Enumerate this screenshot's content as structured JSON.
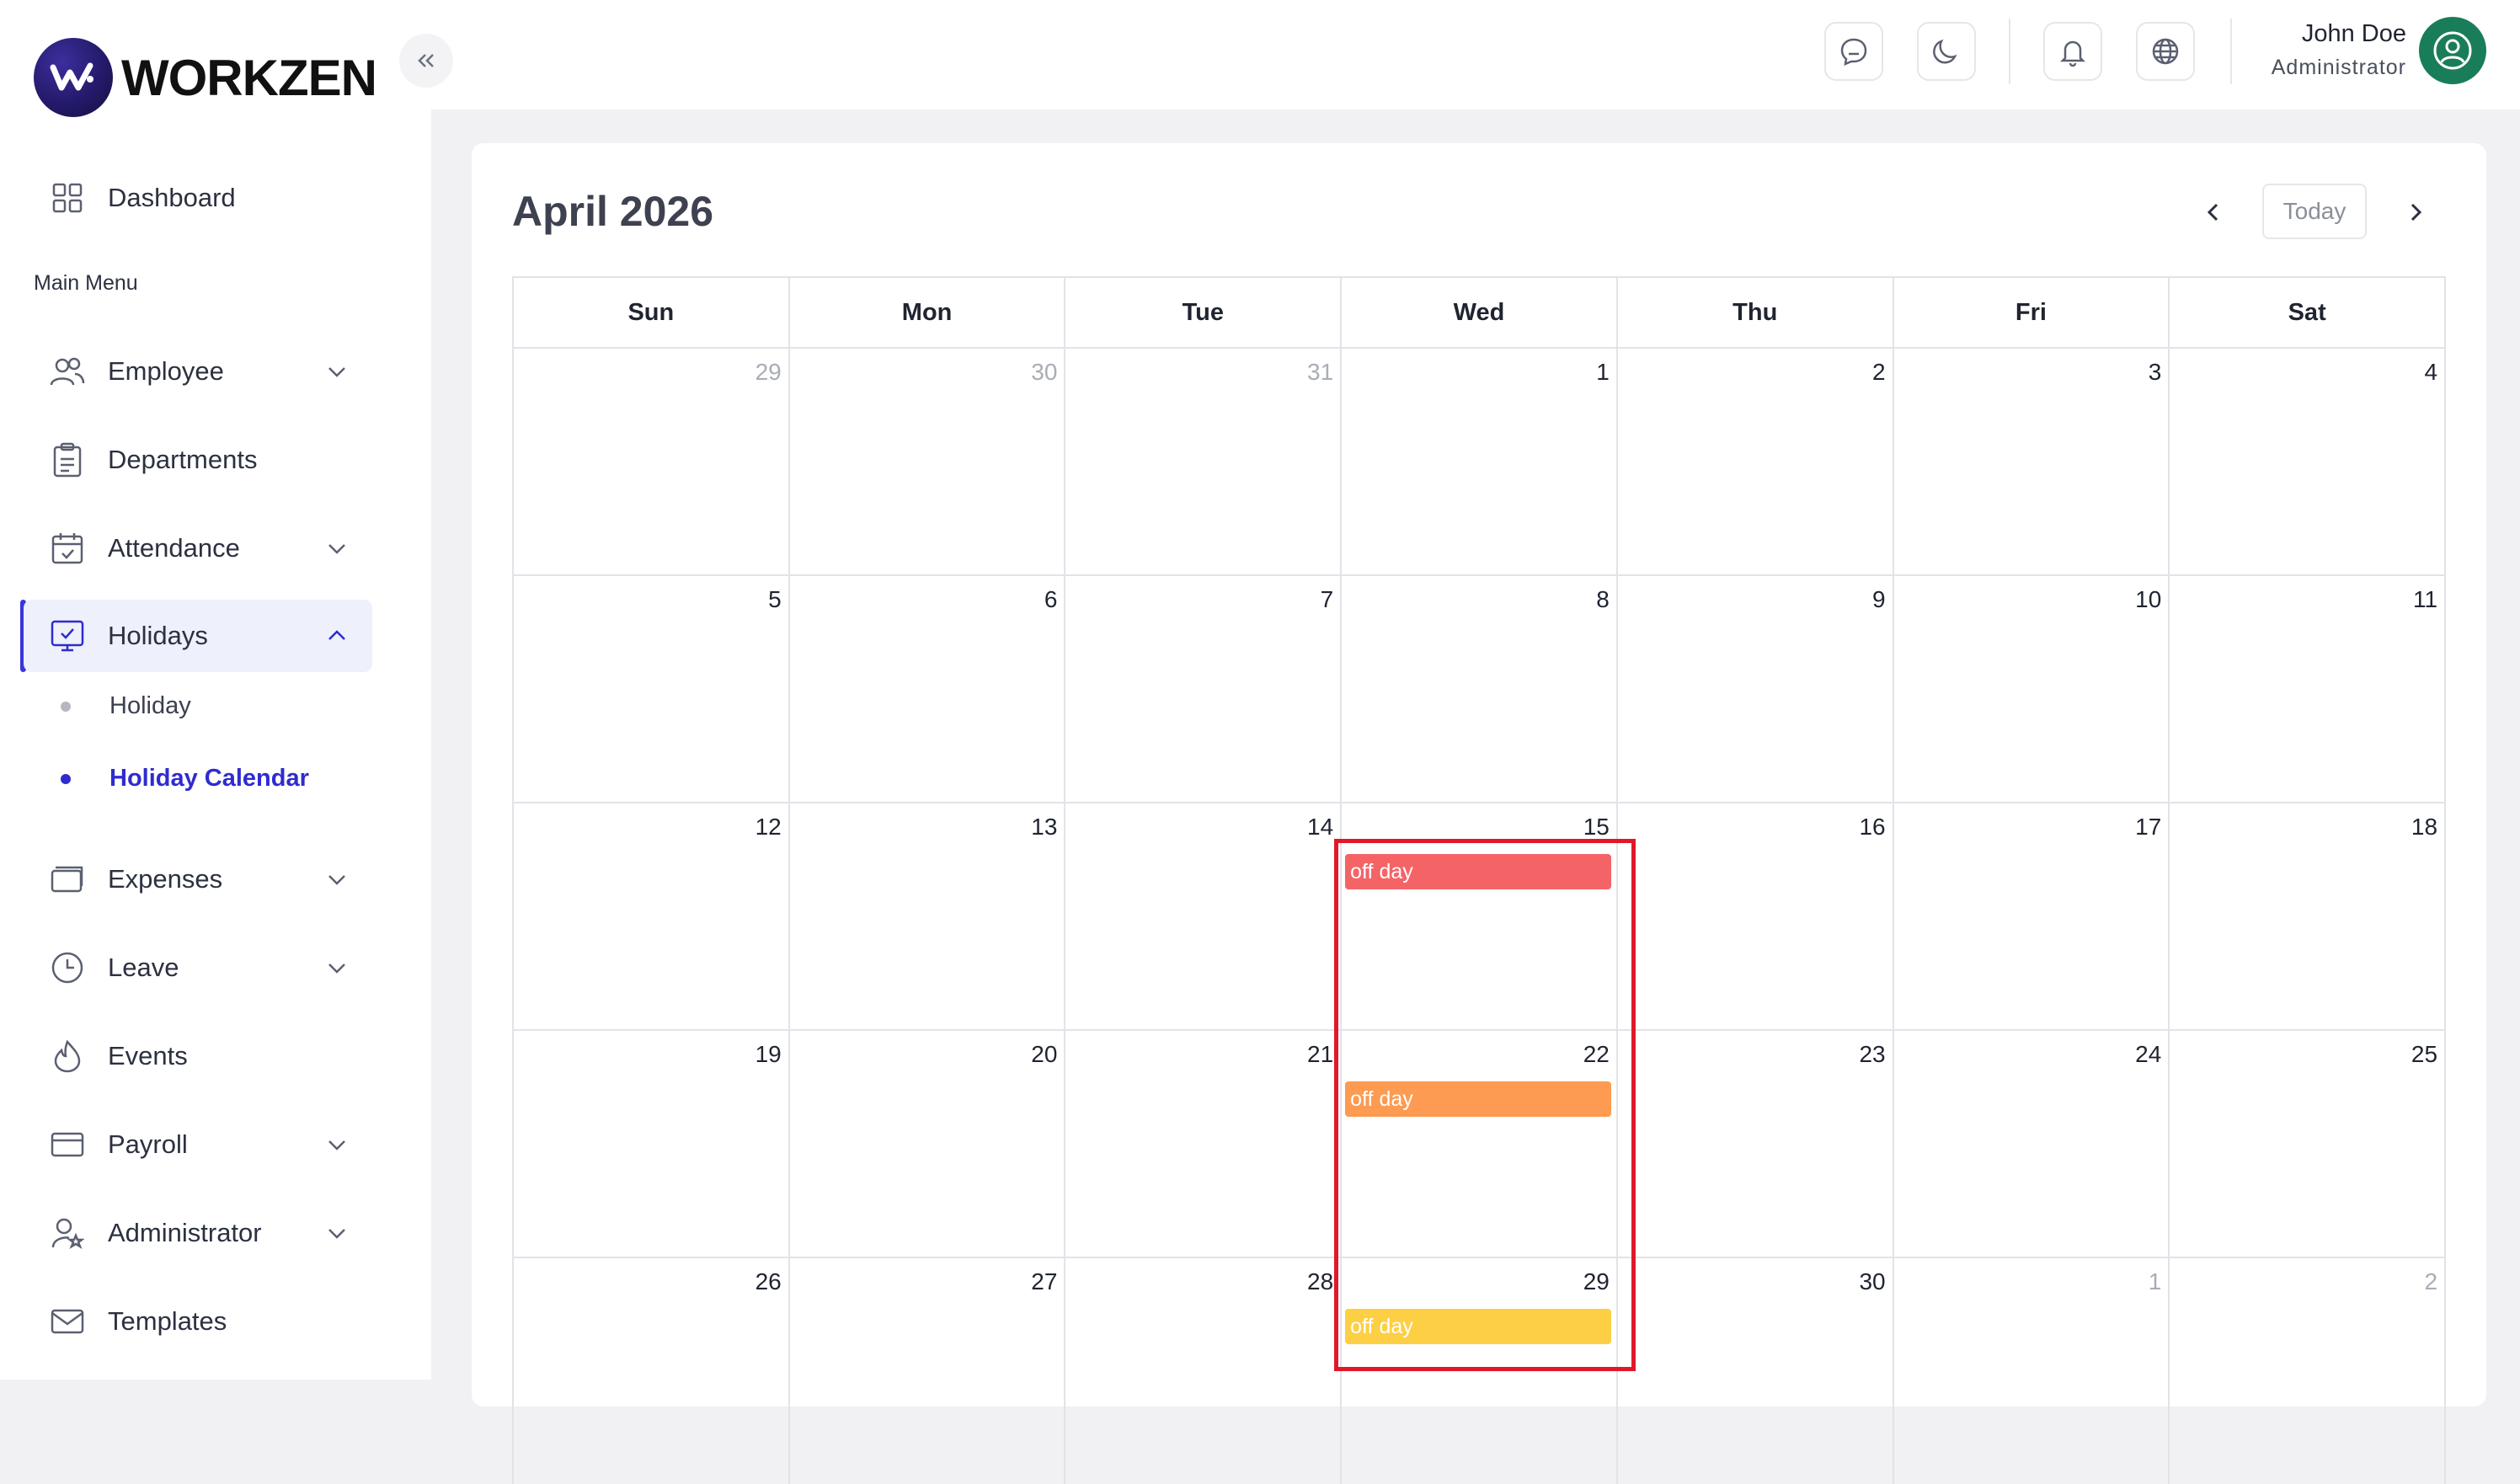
{
  "app": {
    "brand": "WORKZEN"
  },
  "sidebar": {
    "section_label": "Main Menu",
    "items": [
      {
        "label": "Dashboard",
        "icon": "grid-icon"
      },
      {
        "label": "Employee",
        "icon": "users-icon",
        "expandable": true
      },
      {
        "label": "Departments",
        "icon": "clipboard-icon"
      },
      {
        "label": "Attendance",
        "icon": "calendar-check-icon",
        "expandable": true
      },
      {
        "label": "Holidays",
        "icon": "monitor-check-icon",
        "expandable": true,
        "expanded": true,
        "active": true
      },
      {
        "label": "Expenses",
        "icon": "wallet-icon",
        "expandable": true
      },
      {
        "label": "Leave",
        "icon": "clock-icon",
        "expandable": true
      },
      {
        "label": "Events",
        "icon": "flame-icon"
      },
      {
        "label": "Payroll",
        "icon": "credit-card-icon",
        "expandable": true
      },
      {
        "label": "Administrator",
        "icon": "user-star-icon",
        "expandable": true
      },
      {
        "label": "Templates",
        "icon": "mail-icon"
      }
    ],
    "sub_items": [
      {
        "label": "Holiday",
        "active": false
      },
      {
        "label": "Holiday Calendar",
        "active": true
      }
    ]
  },
  "topbar": {
    "buttons": [
      "chat-icon",
      "moon-icon",
      "bell-icon",
      "globe-icon"
    ],
    "user_name": "John Doe",
    "user_role": "Administrator"
  },
  "calendar": {
    "title": "April 2026",
    "today_label": "Today",
    "weekdays": [
      "Sun",
      "Mon",
      "Tue",
      "Wed",
      "Thu",
      "Fri",
      "Sat"
    ],
    "weeks": [
      [
        {
          "d": "29",
          "muted": true
        },
        {
          "d": "30",
          "muted": true
        },
        {
          "d": "31",
          "muted": true
        },
        {
          "d": "1"
        },
        {
          "d": "2"
        },
        {
          "d": "3"
        },
        {
          "d": "4"
        }
      ],
      [
        {
          "d": "5"
        },
        {
          "d": "6"
        },
        {
          "d": "7"
        },
        {
          "d": "8"
        },
        {
          "d": "9"
        },
        {
          "d": "10"
        },
        {
          "d": "11"
        }
      ],
      [
        {
          "d": "12"
        },
        {
          "d": "13"
        },
        {
          "d": "14"
        },
        {
          "d": "15",
          "event": "off day",
          "color": "#f46467"
        },
        {
          "d": "16"
        },
        {
          "d": "17"
        },
        {
          "d": "18"
        }
      ],
      [
        {
          "d": "19"
        },
        {
          "d": "20"
        },
        {
          "d": "21"
        },
        {
          "d": "22",
          "event": "off day",
          "color": "#fc9b51"
        },
        {
          "d": "23"
        },
        {
          "d": "24"
        },
        {
          "d": "25"
        }
      ],
      [
        {
          "d": "26"
        },
        {
          "d": "27"
        },
        {
          "d": "28"
        },
        {
          "d": "29",
          "event": "off day",
          "color": "#fdcf44"
        },
        {
          "d": "30"
        },
        {
          "d": "1",
          "muted": true
        },
        {
          "d": "2",
          "muted": true
        }
      ]
    ]
  },
  "colors": {
    "accent": "#2f2bd0",
    "highlight_border": "#e0182a",
    "avatar": "#1a7d5a"
  }
}
